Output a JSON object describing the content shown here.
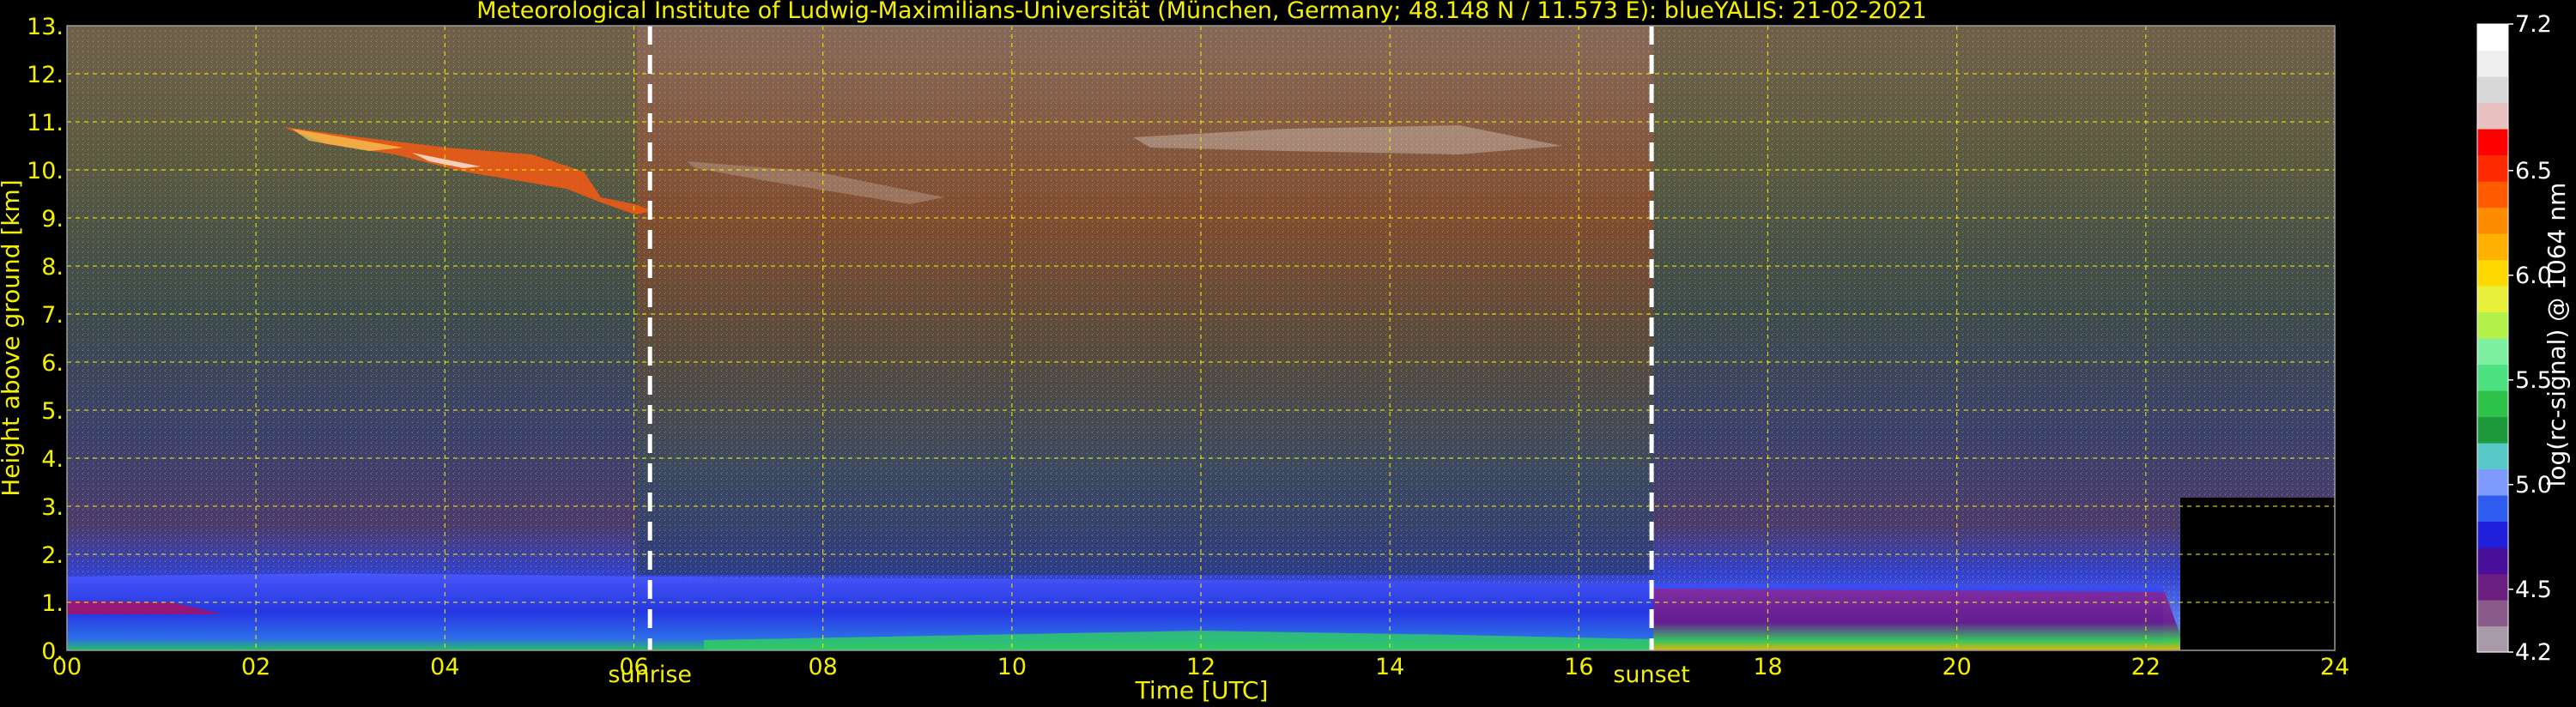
{
  "chart_data": {
    "type": "heatmap",
    "title": "Meteorological Institute of Ludwig-Maximilians-Universität (München, Germany; 48.148 N / 11.573 E):     blueYALIS: 21-02-2021",
    "xlabel": "Time [UTC]",
    "ylabel": "Height above ground [km]",
    "xlim": [
      0,
      24
    ],
    "ylim": [
      0,
      13
    ],
    "x_ticks": [
      "00",
      "02",
      "04",
      "06",
      "08",
      "10",
      "12",
      "14",
      "16",
      "18",
      "20",
      "22",
      "24"
    ],
    "y_ticks": [
      "0.",
      "1.",
      "2.",
      "3.",
      "4.",
      "5.",
      "6.",
      "7.",
      "8.",
      "9.",
      "10.",
      "11.",
      "12.",
      "13."
    ],
    "grid": true,
    "markers": [
      {
        "label": "sunrise",
        "x": 6.17
      },
      {
        "label": "sunset",
        "x": 16.77
      }
    ],
    "colorbar": {
      "label": "log(rc-signal) @ 1064 nm",
      "range": [
        4.2,
        7.2
      ],
      "ticks": [
        "7.2",
        "6.5",
        "6.0",
        "5.5",
        "5.0",
        "4.5",
        "4.2"
      ],
      "colors": [
        "#a89aa8",
        "#8a5b8a",
        "#6a1f80",
        "#4a0f9a",
        "#1f1fdc",
        "#2f5cf0",
        "#7f9aff",
        "#58c8c8",
        "#1e9a3c",
        "#2fc24a",
        "#4be080",
        "#7ff0a0",
        "#b4f04a",
        "#e8f03c",
        "#ffd800",
        "#ffb000",
        "#ff8c00",
        "#ff5a00",
        "#ff2a00",
        "#ff0000",
        "#e8c0c0",
        "#d8d8d8",
        "#eeeeee",
        "#ffffff"
      ]
    }
  }
}
